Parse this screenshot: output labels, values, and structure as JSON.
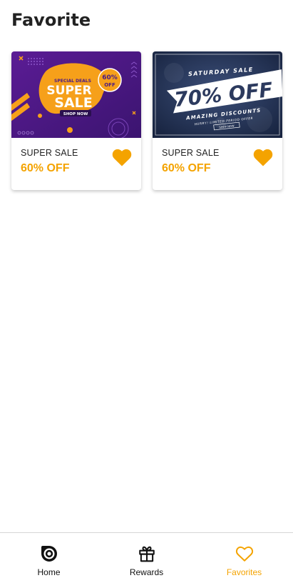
{
  "page": {
    "title": "Favorite"
  },
  "cards": [
    {
      "banner": {
        "tag": "SPECIAL DEALS",
        "line1": "SUPER",
        "line2": "SALE",
        "badge_pct": "60%",
        "badge_off": "OFF",
        "cta": "SHOP NOW"
      },
      "label": "SUPER SALE",
      "discount": "60% OFF",
      "favorited": true
    },
    {
      "banner": {
        "tag": "SATURDAY SALE",
        "headline": "70% OFF",
        "sub1": "AMAZING DISCOUNTS",
        "sub2": "HURRY! LIMITED PERIOD OFFER",
        "cta": "SHOP NOW"
      },
      "label": "SUPER SALE",
      "discount": "60% OFF",
      "favorited": true
    }
  ],
  "nav": {
    "items": [
      {
        "label": "Home",
        "icon": "home-target-icon",
        "active": false
      },
      {
        "label": "Rewards",
        "icon": "gift-icon",
        "active": false
      },
      {
        "label": "Favorites",
        "icon": "heart-outline-icon",
        "active": true
      }
    ]
  },
  "colors": {
    "accent": "#f4a300",
    "text": "#222222",
    "banner1_bg": "#4a1a86",
    "banner2_bg": "#1f2d4f"
  }
}
